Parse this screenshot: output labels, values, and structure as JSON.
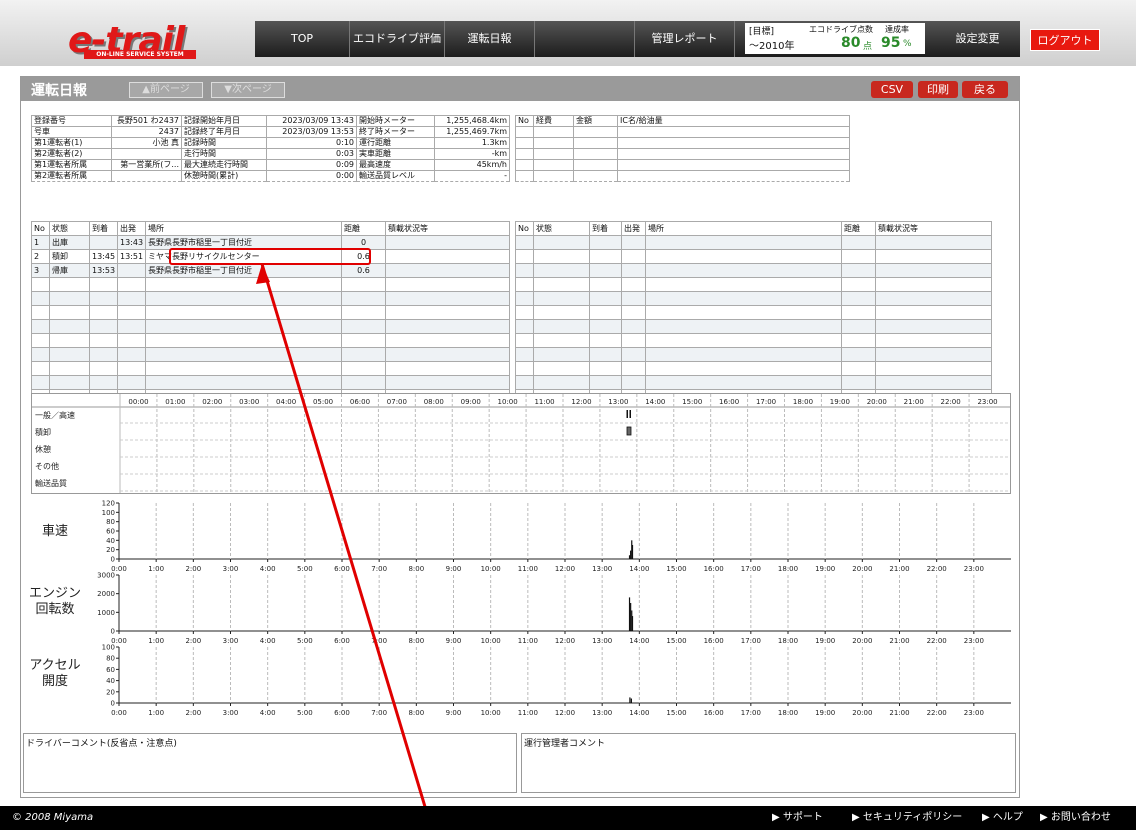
{
  "header": {
    "logo": "e-trail",
    "logo_sub": "ON-LINE SERVICE SYSTEM",
    "nav": [
      {
        "label": "TOP"
      },
      {
        "label": "エコドライブ評価"
      },
      {
        "label": "運転日報"
      },
      {
        "label": ""
      },
      {
        "label": "管理レポート"
      }
    ],
    "target": {
      "label": "[目標]",
      "period": "～2010年",
      "eco_label": "エコドライブ点数",
      "rate_label": "達成率",
      "score": "80",
      "score_unit": "点",
      "rate": "95",
      "rate_unit": "%"
    },
    "settings": "設定変更",
    "logout": "ログアウト"
  },
  "page": {
    "title": "運転日報",
    "prev": "▲前ページ",
    "next": "▼次ページ",
    "csv": "CSV",
    "print": "印刷",
    "back": "戻る"
  },
  "info": {
    "left": [
      [
        "登録番号",
        "長野501 わ2437",
        "記録開始年月日",
        "2023/03/09 13:43",
        "開始時メーター",
        "1,255,468.4km"
      ],
      [
        "号車",
        "2437",
        "記録終了年月日",
        "2023/03/09 13:53",
        "終了時メーター",
        "1,255,469.7km"
      ],
      [
        "第1運転者(1)",
        "小池 真",
        "記録時間",
        "0:10",
        "運行距離",
        "1.3km"
      ],
      [
        "第2運転者(2)",
        "",
        "走行時間",
        "0:03",
        "実車距離",
        "-km"
      ],
      [
        "第1運転者所属",
        "第一営業所(フ...",
        "最大連続走行時間",
        "0:09",
        "最高速度",
        "45km/h"
      ],
      [
        "第2運転者所属",
        "",
        "休憩時間(累計)",
        "0:00",
        "輸送品質レベル",
        "-"
      ]
    ],
    "expense_headers": [
      "No",
      "経費",
      "金額",
      "IC名/給油量"
    ]
  },
  "trips": {
    "headers": [
      "No",
      "状態",
      "到着",
      "出発",
      "場所",
      "距離",
      "積載状況等"
    ],
    "rows": [
      [
        "1",
        "出庫",
        "",
        "13:43",
        "長野県長野市稲里一丁目付近",
        "0",
        ""
      ],
      [
        "2",
        "積卸",
        "13:45",
        "13:51",
        "ミヤマ長野リサイクルセンター",
        "0.6",
        ""
      ],
      [
        "3",
        "帰庫",
        "13:53",
        "",
        "長野県長野市稲里一丁目付近",
        "0.6",
        ""
      ]
    ],
    "right_headers": [
      "No",
      "状態",
      "到着",
      "出発",
      "場所",
      "距離",
      "積載状況等"
    ]
  },
  "timeline": {
    "hours": [
      "00:00",
      "01:00",
      "02:00",
      "03:00",
      "04:00",
      "05:00",
      "06:00",
      "07:00",
      "08:00",
      "09:00",
      "10:00",
      "11:00",
      "12:00",
      "13:00",
      "14:00",
      "15:00",
      "16:00",
      "17:00",
      "18:00",
      "19:00",
      "20:00",
      "21:00",
      "22:00",
      "23:00"
    ],
    "rows": [
      "一般／高速",
      "積卸",
      "休憩",
      "その他",
      "輸送品質"
    ]
  },
  "charts": {
    "x_ticks": [
      "0:00",
      "1:00",
      "2:00",
      "3:00",
      "4:00",
      "5:00",
      "6:00",
      "7:00",
      "8:00",
      "9:00",
      "10:00",
      "11:00",
      "12:00",
      "13:00",
      "14:00",
      "15:00",
      "16:00",
      "17:00",
      "18:00",
      "19:00",
      "20:00",
      "21:00",
      "22:00",
      "23:00"
    ]
  },
  "chart_data": [
    {
      "type": "bar",
      "title": "車速",
      "ylim": [
        0,
        120
      ],
      "yticks": [
        0,
        20,
        40,
        60,
        80,
        100,
        120
      ],
      "series": [
        {
          "values": [
            [
              13.72,
              8
            ],
            [
              13.75,
              18
            ],
            [
              13.78,
              40
            ],
            [
              13.8,
              30
            ]
          ]
        }
      ]
    },
    {
      "type": "bar",
      "title": "エンジン回転数",
      "ylim": [
        0,
        3000
      ],
      "yticks": [
        0,
        1000,
        2000,
        3000
      ],
      "series": [
        {
          "values": [
            [
              13.72,
              1800
            ],
            [
              13.75,
              1500
            ],
            [
              13.78,
              1100
            ],
            [
              13.8,
              800
            ]
          ]
        }
      ]
    },
    {
      "type": "bar",
      "title": "アクセル開度",
      "ylim": [
        0,
        100
      ],
      "yticks": [
        0,
        20,
        40,
        60,
        80,
        100
      ],
      "series": [
        {
          "values": [
            [
              13.73,
              10
            ],
            [
              13.77,
              8
            ]
          ]
        }
      ]
    }
  ],
  "comments": {
    "driver": "ドライバーコメント(反省点・注意点)",
    "manager": "運行管理者コメント"
  },
  "footer": {
    "copyright": "© 2008 Miyama",
    "links": [
      "▶ サポート",
      "▶ セキュリティポリシー",
      "▶ ヘルプ",
      "▶ お問い合わせ"
    ]
  },
  "colors": {
    "accent": "#e01818",
    "highlight": "#e00000",
    "score": "#2a8a2a"
  }
}
